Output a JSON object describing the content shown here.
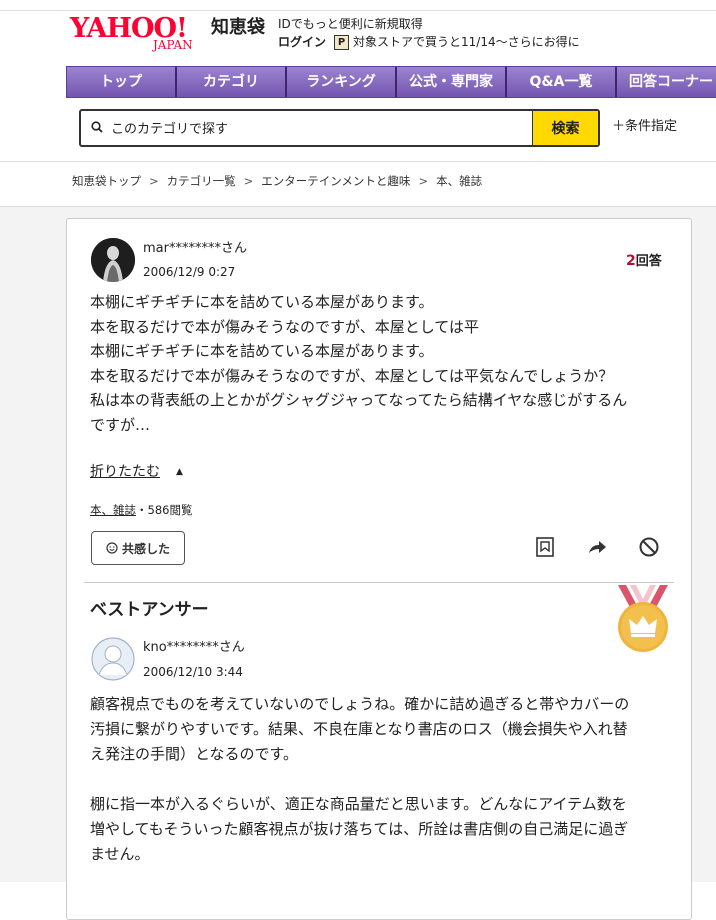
{
  "header": {
    "logo_text": "YAHOO!",
    "logo_sub": "JAPAN",
    "service_name": "知恵袋",
    "promo_line1": "IDでもっと便利に新規取得",
    "login_label": "ログイン",
    "promo_line2": "対象ストアで買うと11/14～さらにお得に",
    "pp_icon": "P"
  },
  "nav": {
    "items": [
      "トップ",
      "カテゴリ",
      "ランキング",
      "公式・専門家",
      "Q&A一覧",
      "回答コーナー"
    ]
  },
  "search": {
    "placeholder": "このカテゴリで探す",
    "button_label": "検索",
    "condition_label": "＋条件指定"
  },
  "breadcrumb": [
    "知恵袋トップ",
    "カテゴリ一覧",
    "エンターテインメントと趣味",
    "本、雑誌"
  ],
  "question": {
    "user": "mar********さん",
    "date": "2006/12/9 0:27",
    "answer_count": "2",
    "answer_suffix": "回答",
    "body": [
      "本棚にギチギチに本を詰めている本屋があります。",
      "本を取るだけで本が傷みそうなのですが、本屋としては平",
      "本棚にギチギチに本を詰めている本屋があります。",
      "本を取るだけで本が傷みそうなのですが、本屋としては平気なんでしょうか？",
      "私は本の背表紙の上とかがグシャグジャってなってたら結構イヤな感じがするん",
      "ですが…"
    ],
    "fold_label": "折りたたむ",
    "category": "本、雑誌",
    "views": "・586閲覧",
    "empathy_label": "共感した"
  },
  "best_answer": {
    "title": "ベストアンサー",
    "user": "kno********さん",
    "date": "2006/12/10 3:44",
    "body": [
      "顧客視点でものを考えていないのでしょうね。確かに詰め過ぎると帯やカバーの",
      "汚損に繋がりやすいです。結果、不良在庫となり書店のロス（機会損失や入れ替",
      "え発注の手間）となるのです。",
      "",
      "棚に指一本が入るぐらいが、適正な商品量だと思います。どんなにアイテム数を",
      "増やしてもそういった顧客視点が抜け落ちては、所詮は書店側の自己満足に過ぎ",
      "ません。"
    ]
  },
  "colors": {
    "brand_red": "#ff0033",
    "nav_purple": "#7c5fb8",
    "search_button": "#ffd900",
    "answer_count": "#b3122e",
    "medal_gold": "#f0b43c"
  }
}
